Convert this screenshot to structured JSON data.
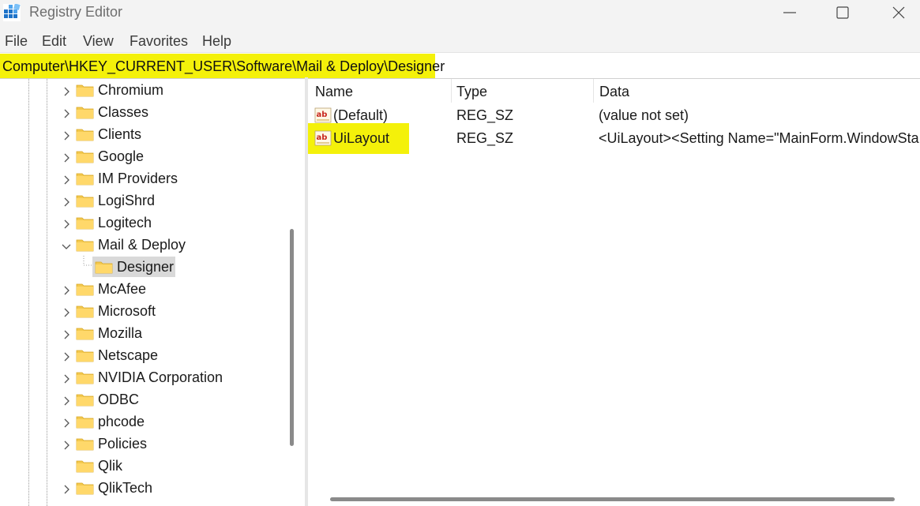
{
  "window": {
    "title": "Registry Editor",
    "controls": [
      "minimize",
      "maximize",
      "close"
    ]
  },
  "menu": {
    "items": [
      {
        "label": "File"
      },
      {
        "label": "Edit"
      },
      {
        "label": "View"
      },
      {
        "label": "Favorites"
      },
      {
        "label": "Help"
      }
    ]
  },
  "address": {
    "path": "Computer\\HKEY_CURRENT_USER\\Software\\Mail & Deploy\\Designer",
    "highlight_color": "#f4f10a"
  },
  "tree": {
    "items": [
      {
        "label": "Chromium",
        "expander": "collapsed"
      },
      {
        "label": "Classes",
        "expander": "collapsed"
      },
      {
        "label": "Clients",
        "expander": "collapsed"
      },
      {
        "label": "Google",
        "expander": "collapsed"
      },
      {
        "label": "IM Providers",
        "expander": "collapsed"
      },
      {
        "label": "LogiShrd",
        "expander": "collapsed"
      },
      {
        "label": "Logitech",
        "expander": "collapsed"
      },
      {
        "label": "Mail & Deploy",
        "expander": "expanded"
      },
      {
        "label": "Designer",
        "expander": "none",
        "child": true,
        "selected": true
      },
      {
        "label": "McAfee",
        "expander": "collapsed"
      },
      {
        "label": "Microsoft",
        "expander": "collapsed"
      },
      {
        "label": "Mozilla",
        "expander": "collapsed"
      },
      {
        "label": "Netscape",
        "expander": "collapsed"
      },
      {
        "label": "NVIDIA Corporation",
        "expander": "collapsed"
      },
      {
        "label": "ODBC",
        "expander": "collapsed"
      },
      {
        "label": "phcode",
        "expander": "collapsed"
      },
      {
        "label": "Policies",
        "expander": "collapsed"
      },
      {
        "label": "Qlik",
        "expander": "none"
      },
      {
        "label": "QlikTech",
        "expander": "collapsed"
      }
    ]
  },
  "values": {
    "columns": {
      "name": "Name",
      "type": "Type",
      "data": "Data"
    },
    "rows": [
      {
        "name": "(Default)",
        "type": "REG_SZ",
        "data": "(value not set)",
        "icon": "string-value-icon"
      },
      {
        "name": "UiLayout",
        "type": "REG_SZ",
        "data": "<UiLayout><Setting Name=\"MainForm.WindowSta",
        "icon": "string-value-icon",
        "highlighted": true
      }
    ]
  }
}
